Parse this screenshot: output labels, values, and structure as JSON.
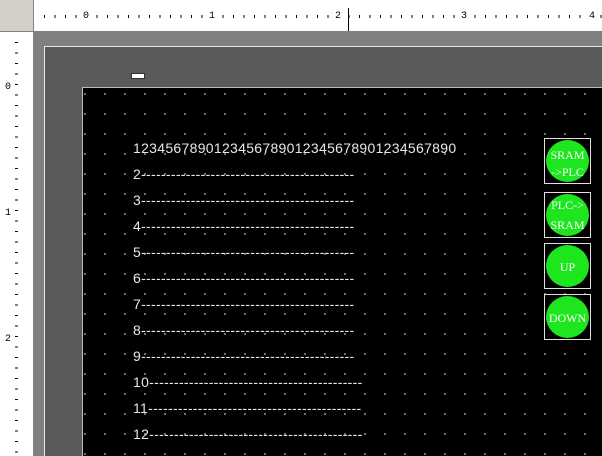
{
  "hruler": {
    "labels": [
      "0",
      "1",
      "2",
      "3",
      "4"
    ]
  },
  "vruler": {
    "labels": [
      "0",
      "1",
      "2"
    ]
  },
  "lines": [
    "1234567890123456789012345678901234567890",
    "2-------------------------------------------",
    "3-------------------------------------------",
    "4-------------------------------------------",
    "5-------------------------------------------",
    "6-------------------------------------------",
    "7-------------------------------------------",
    "8-------------------------------------------",
    "9-------------------------------------------",
    "10-------------------------------------------",
    "11-------------------------------------------",
    "12-------------------------------------------"
  ],
  "buttons": [
    {
      "line1": "SRAM",
      "line2": "->PLC"
    },
    {
      "line1": "PLC->",
      "line2": "SRAM"
    },
    {
      "line1": "UP",
      "line2": ""
    },
    {
      "line1": "DOWN",
      "line2": ""
    }
  ],
  "colors": {
    "screen_bg": "#000000",
    "button_fill": "#1ee61e",
    "text": "#e8e8e8",
    "workspace": "#808080"
  }
}
